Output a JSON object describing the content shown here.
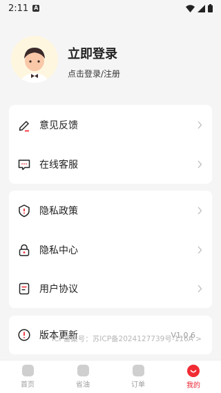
{
  "status_bar": {
    "time": "2:11"
  },
  "profile": {
    "title": "立即登录",
    "subtitle": "点击登录/注册"
  },
  "card1": {
    "items": [
      {
        "label": "意见反馈",
        "icon": "edit-pencil-icon"
      },
      {
        "label": "在线客服",
        "icon": "chat-bubble-icon"
      }
    ]
  },
  "card2": {
    "items": [
      {
        "label": "隐私政策",
        "icon": "shield-icon"
      },
      {
        "label": "隐私中心",
        "icon": "lock-icon"
      },
      {
        "label": "用户协议",
        "icon": "document-icon"
      }
    ]
  },
  "card3": {
    "item": {
      "label": "版本更新",
      "icon": "info-circle-icon"
    },
    "icp_text": "ICP备案号：苏ICP备2024127739号-116A >",
    "version": "V1.0.6"
  },
  "tabs": [
    {
      "label": "首页",
      "icon": "home-icon",
      "active": false
    },
    {
      "label": "省油",
      "icon": "fuel-icon",
      "active": false
    },
    {
      "label": "订单",
      "icon": "order-icon",
      "active": false
    },
    {
      "label": "我的",
      "icon": "profile-smile-icon",
      "active": true
    }
  ],
  "colors": {
    "accent": "#f12b33",
    "background": "#f5f5f5",
    "card": "#ffffff"
  }
}
